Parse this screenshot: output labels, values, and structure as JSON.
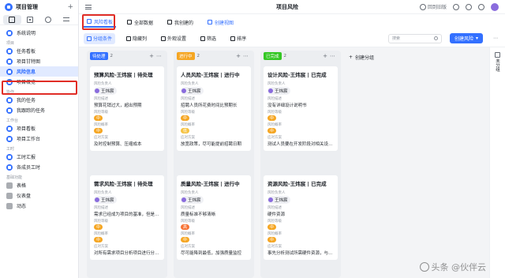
{
  "app": {
    "title": "项目管理"
  },
  "sidebar": {
    "top_item": "系统说明",
    "groups": [
      {
        "label": "项目",
        "items": [
          "任务看板",
          "项目甘特图",
          "风险信息",
          "项目概览"
        ]
      },
      {
        "label": "协作",
        "items": [
          "我的任务",
          "我跟踪的任务"
        ]
      },
      {
        "label": "工作台",
        "items": [
          "项目看板",
          "项目工作台"
        ]
      },
      {
        "label": "工时",
        "items": [
          "工时汇报",
          "各成员工时"
        ]
      },
      {
        "label": "基础功能",
        "items": [
          "表格",
          "仪表盘",
          "动态"
        ]
      }
    ]
  },
  "topbar": {
    "title": "项目风险",
    "recycle": "回到旧版"
  },
  "views": {
    "tabs": [
      "风险看板",
      "全部数据",
      "我创建的"
    ],
    "create": "创建视图"
  },
  "toolbar": {
    "items": [
      "分组条件",
      "隐藏列",
      "外观设置",
      "筛选",
      "排序"
    ],
    "search_placeholder": "搜索",
    "create_button": "创建风险"
  },
  "board": {
    "add_group": "创建分组",
    "columns": [
      {
        "tag": "待处理",
        "count": "2",
        "color": "#3370ff",
        "cards": [
          {
            "title": "预算风险-王炜宸 | 待处理",
            "owner_label": "风险负责人",
            "owner": "王炜宸",
            "desc_label": "风险描述",
            "desc": "预算花销过大，超出预期",
            "level_label": "风险等级",
            "level": "中",
            "level_color": "#f5a623",
            "prob_label": "风险概率",
            "prob": "中",
            "prob_color": "#f5a623",
            "plan_label": "应对方案",
            "plan": "及时控制预算、压缩成本"
          },
          {
            "title": "需求风险-王炜宸 | 待处理",
            "owner_label": "风险负责人",
            "owner": "王炜宸",
            "desc_label": "风险描述",
            "desc": "需求已经成为项目的基准，但是变…",
            "level_label": "风险等级",
            "level": "中",
            "level_color": "#f5a623",
            "prob_label": "风险概率",
            "prob": "中",
            "prob_color": "#f5a623",
            "plan_label": "应对方案",
            "plan": "对所有需求项目分析项目进行分类…"
          }
        ]
      },
      {
        "tag": "进行中",
        "count": "2",
        "color": "#f5a623",
        "cards": [
          {
            "title": "人员风险-王炜宸 | 进行中",
            "owner_label": "风险负责人",
            "owner": "王炜宸",
            "desc_label": "风险描述",
            "desc": "招聘人员所花费时间比预期长",
            "level_label": "风险等级",
            "level": "中",
            "level_color": "#f5a623",
            "prob_label": "风险概率",
            "prob": "低",
            "prob_color": "#f5c242",
            "plan_label": "应对方案",
            "plan": "放宽政策，尽可能提前招聘日期"
          },
          {
            "title": "质量风险-王炜宸 | 进行中",
            "owner_label": "风险负责人",
            "owner": "王炜宸",
            "desc_label": "风险描述",
            "desc": "质量标准不够清晰",
            "level_label": "风险等级",
            "level": "高",
            "level_color": "#f77234",
            "prob_label": "风险概率",
            "prob": "中",
            "prob_color": "#f5a623",
            "plan_label": "应对方案",
            "plan": "尽可能降到最低，加强质量监控"
          }
        ]
      },
      {
        "tag": "已完成",
        "count": "2",
        "color": "#34c724",
        "cards": [
          {
            "title": "设计风险-王炜宸 | 已完成",
            "owner_label": "风险负责人",
            "owner": "王炜宸",
            "desc_label": "风险描述",
            "desc": "没有详细设计说明书",
            "level_label": "风险等级",
            "level": "中",
            "level_color": "#f5a623",
            "prob_label": "风险概率",
            "prob": "中",
            "prob_color": "#f5a623",
            "plan_label": "应对方案",
            "plan": "测试人员要在开发阶段对相关设计…"
          },
          {
            "title": "资源风险-王炜宸 | 已完成",
            "owner_label": "风险负责人",
            "owner": "王炜宸",
            "desc_label": "风险描述",
            "desc": "硬件资源",
            "level_label": "风险等级",
            "level": "中",
            "level_color": "#f5a623",
            "prob_label": "风险概率",
            "prob": "中",
            "prob_color": "#f5a623",
            "plan_label": "应对方案",
            "plan": "事先分析测试所需硬件资源，与这…"
          }
        ]
      }
    ]
  },
  "right_panel": {
    "label": "未分组"
  },
  "watermark": "头条 @伙伴云"
}
